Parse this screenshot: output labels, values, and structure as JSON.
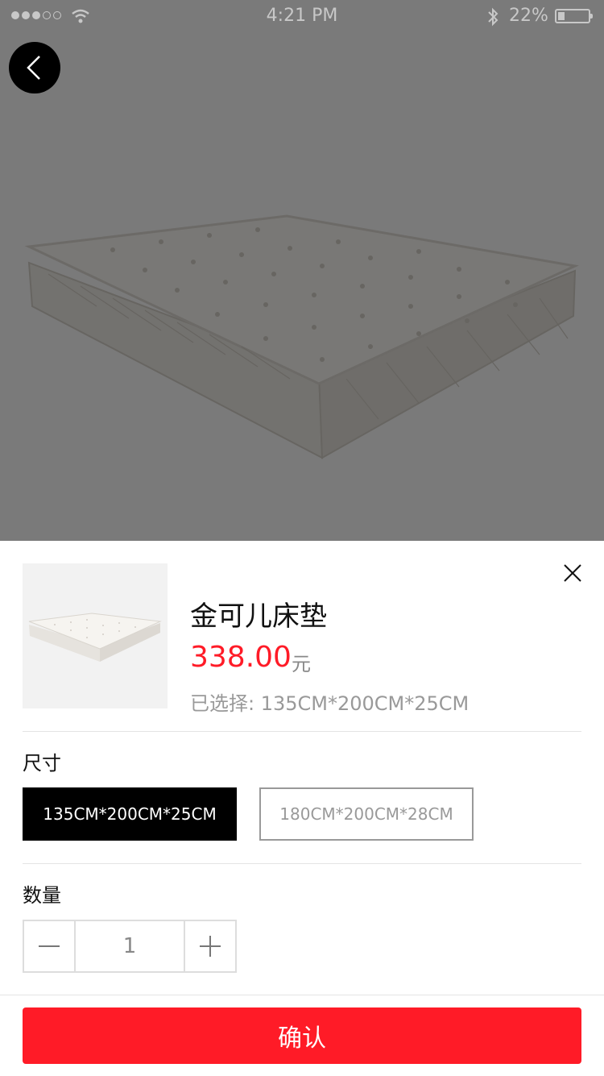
{
  "status_bar": {
    "time": "4:21 PM",
    "battery_percent_text": "22%",
    "battery_level": 0.22,
    "signal_bars_filled": 3,
    "signal_bars_total": 5
  },
  "hero": {
    "back_icon": "chevron-left-icon",
    "image": "mattress"
  },
  "sheet": {
    "close_icon": "close-icon",
    "product_title": "金可儿床垫",
    "price": "338.00",
    "price_unit": "元",
    "selected_text": "已选择: 135CM*200CM*25CM",
    "size_label": "尺寸",
    "size_options": [
      {
        "label": "135CM*200CM*25CM",
        "selected": true
      },
      {
        "label": "180CM*200CM*28CM",
        "selected": false
      }
    ],
    "quantity_label": "数量",
    "quantity": "1",
    "confirm_label": "确认"
  },
  "colors": {
    "accent": "#ff1b27",
    "selected_option_bg": "#000000"
  }
}
